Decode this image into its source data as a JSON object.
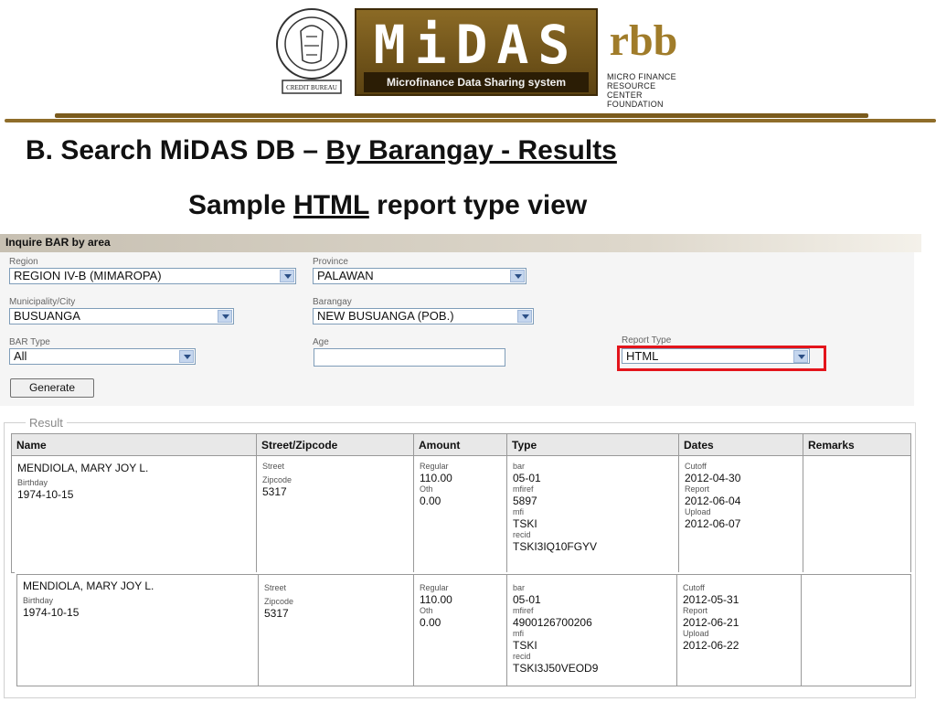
{
  "header": {
    "seal_caption": "CREDIT BUREAU",
    "midas_logo": "MiDAS",
    "midas_tagline": "Microfinance Data Sharing system",
    "rbb_logo": "rbb",
    "rbb_caption": [
      "MICRO FINANCE",
      "RESOURCE CENTER",
      "FOUNDATION"
    ]
  },
  "title": {
    "prefix": "B.  Search MiDAS DB – ",
    "underlined": "By Barangay - Results"
  },
  "subtitle": {
    "before": "Sample ",
    "underlined": "HTML",
    "after": " report type view"
  },
  "form": {
    "header": "Inquire BAR by area",
    "region_label": "Region",
    "region_value": "REGION IV-B (MIMAROPA)",
    "province_label": "Province",
    "province_value": "PALAWAN",
    "municipality_label": "Municipality/City",
    "municipality_value": "BUSUANGA",
    "barangay_label": "Barangay",
    "barangay_value": "NEW BUSUANGA (POB.)",
    "bar_type_label": "BAR Type",
    "bar_type_value": "All",
    "age_label": "Age",
    "age_value": "",
    "report_type_label": "Report Type",
    "report_type_value": "HTML",
    "generate_label": "Generate"
  },
  "result": {
    "legend": "Result",
    "columns": [
      "Name",
      "Street/Zipcode",
      "Amount",
      "Type",
      "Dates",
      "Remarks"
    ],
    "rows": [
      {
        "name": "MENDIOLA, MARY JOY L.",
        "birthday_label": "Birthday",
        "birthday": "1974-10-15",
        "street_label": "Street",
        "zipcode_label": "Zipcode",
        "zipcode": "5317",
        "regular_label": "Regular",
        "regular": "110.00",
        "oth_label": "Oth",
        "oth": "0.00",
        "bar_label": "bar",
        "bar": "05-01",
        "mfiref_label": "mfiref",
        "mfiref": "5897",
        "mfi_label": "mfi",
        "mfi": "TSKI",
        "recid_label": "recid",
        "recid": "TSKI3IQ10FGYV",
        "cutoff_label": "Cutoff",
        "cutoff": "2012-04-30",
        "report_label": "Report",
        "report": "2012-06-04",
        "upload_label": "Upload",
        "upload": "2012-06-07",
        "remarks": ""
      },
      {
        "name": "MENDIOLA, MARY JOY L.",
        "birthday_label": "Birthday",
        "birthday": "1974-10-15",
        "street_label": "Street",
        "zipcode_label": "Zipcode",
        "zipcode": "5317",
        "regular_label": "Regular",
        "regular": "110.00",
        "oth_label": "Oth",
        "oth": "0.00",
        "bar_label": "bar",
        "bar": "05-01",
        "mfiref_label": "mfiref",
        "mfiref": "4900126700206",
        "mfi_label": "mfi",
        "mfi": "TSKI",
        "recid_label": "recid",
        "recid": "TSKI3J50VEOD9",
        "cutoff_label": "Cutoff",
        "cutoff": "2012-05-31",
        "report_label": "Report",
        "report": "2012-06-21",
        "upload_label": "Upload",
        "upload": "2012-06-22",
        "remarks": ""
      }
    ]
  },
  "colors": {
    "gold": "#7a5a1c",
    "highlight_red": "#e3141b",
    "select_border": "#7f9db9"
  }
}
